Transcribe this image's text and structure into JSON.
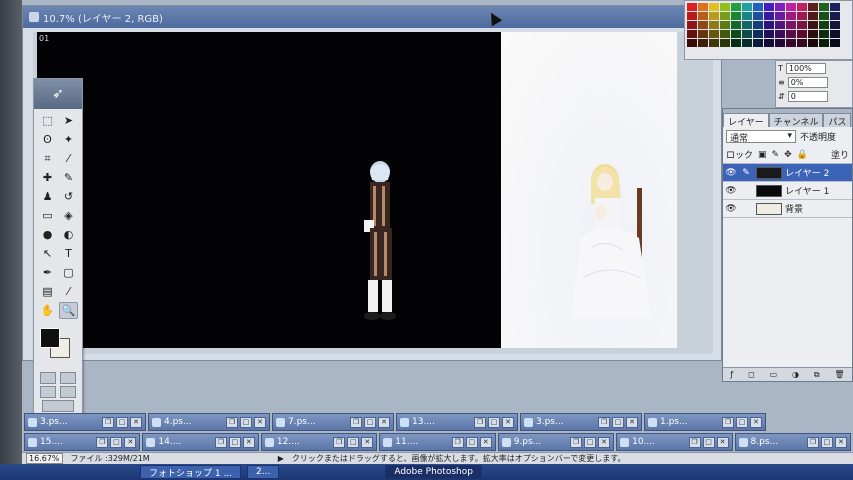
{
  "document": {
    "title": "10.7% (レイヤー 2, RGB)",
    "ruler_tag": "01"
  },
  "toolbox": {
    "tools": [
      {
        "name": "marquee-tool",
        "glyph": "⬚"
      },
      {
        "name": "move-tool",
        "glyph": "➤"
      },
      {
        "name": "lasso-tool",
        "glyph": "ʘ"
      },
      {
        "name": "magic-wand-tool",
        "glyph": "✦"
      },
      {
        "name": "crop-tool",
        "glyph": "⌗"
      },
      {
        "name": "slice-tool",
        "glyph": "⁄"
      },
      {
        "name": "heal-tool",
        "glyph": "✚"
      },
      {
        "name": "brush-tool",
        "glyph": "✎"
      },
      {
        "name": "stamp-tool",
        "glyph": "♟"
      },
      {
        "name": "history-brush-tool",
        "glyph": "↺"
      },
      {
        "name": "eraser-tool",
        "glyph": "▭"
      },
      {
        "name": "bucket-tool",
        "glyph": "◈"
      },
      {
        "name": "blur-tool",
        "glyph": "●"
      },
      {
        "name": "dodge-tool",
        "glyph": "◐"
      },
      {
        "name": "path-select-tool",
        "glyph": "↖"
      },
      {
        "name": "type-tool",
        "glyph": "T"
      },
      {
        "name": "pen-tool",
        "glyph": "✒"
      },
      {
        "name": "shape-tool",
        "glyph": "▢"
      },
      {
        "name": "notes-tool",
        "glyph": "▤"
      },
      {
        "name": "eyedropper-tool",
        "glyph": "⁄"
      },
      {
        "name": "hand-tool",
        "glyph": "✋"
      },
      {
        "name": "zoom-tool",
        "glyph": "🔍"
      }
    ]
  },
  "character": {
    "size_value": "100%",
    "tracking_value": "0%",
    "baseline_value": "0"
  },
  "layers": {
    "tabs": [
      "レイヤー",
      "チャンネル",
      "パス"
    ],
    "blend_mode": "通常",
    "opacity_label": "不透明度",
    "lock_label": "ロック",
    "fill_label": "塗り",
    "items": [
      {
        "name": "レイヤー 2",
        "thumb": "#1a1a1a"
      },
      {
        "name": "レイヤー 1",
        "thumb": "#0a0a0a"
      },
      {
        "name": "背景",
        "thumb": "#efece4"
      }
    ]
  },
  "minimized_docs": {
    "row1": [
      "3.ps...",
      "4.ps...",
      "7.ps...",
      "13....",
      "3.ps...",
      "1.ps..."
    ],
    "row2": [
      "15....",
      "14....",
      "12....",
      "11....",
      "9.ps...",
      "10....",
      "8.ps..."
    ]
  },
  "status": {
    "zoom": "16.67%",
    "file_info": "ファイル :329M/21M",
    "hint": "クリックまたはドラッグすると、画像が拡大します。拡大率はオプションバーで変更します。"
  },
  "taskbar": {
    "items": [
      "フォトショップ 1 ...",
      "2...",
      "Adobe Photoshop"
    ]
  },
  "colors": {
    "foreground": "#111111",
    "background": "#f0ede6",
    "selection": "#3b63b8"
  }
}
